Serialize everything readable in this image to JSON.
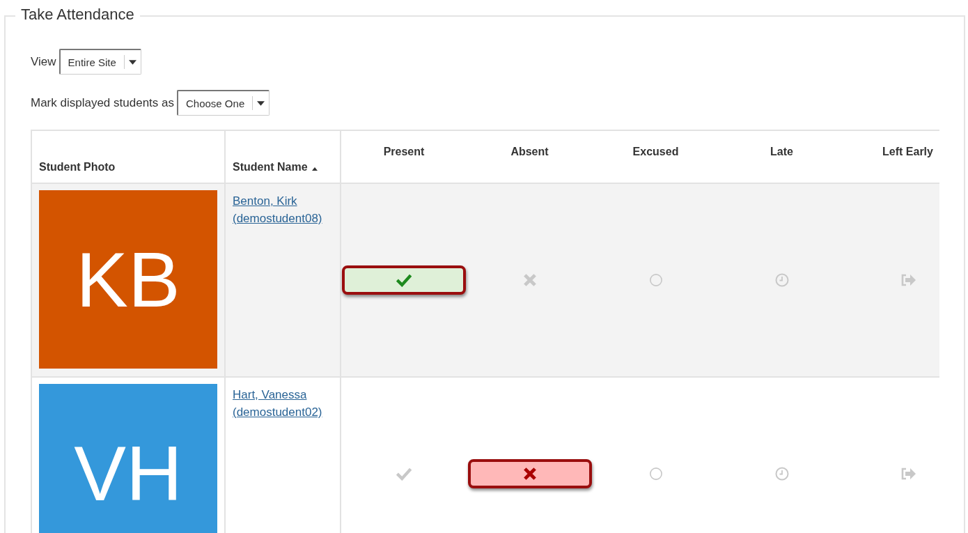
{
  "panel": {
    "title": "Take Attendance"
  },
  "view": {
    "label": "View",
    "value": "Entire Site"
  },
  "mark_all": {
    "label": "Mark displayed students as",
    "value": "Choose One"
  },
  "table": {
    "columns": [
      {
        "label": "Student Photo",
        "kind": "photo"
      },
      {
        "label": "Student Name",
        "kind": "name",
        "sorted": true
      },
      {
        "label": "Present",
        "kind": "present"
      },
      {
        "label": "Absent",
        "kind": "absent"
      },
      {
        "label": "Excused",
        "kind": "excused"
      },
      {
        "label": "Late",
        "kind": "late"
      },
      {
        "label": "Left Early",
        "kind": "left_early"
      }
    ],
    "rows": [
      {
        "initials": "KB",
        "color": "#d35400",
        "name": "Benton, Kirk (demostudent08)",
        "shaded": true,
        "statuses": [
          {
            "kind": "present",
            "selected": true
          },
          {
            "kind": "absent",
            "selected": false
          },
          {
            "kind": "excused",
            "selected": false
          },
          {
            "kind": "late",
            "selected": false
          },
          {
            "kind": "left_early",
            "selected": false
          }
        ]
      },
      {
        "initials": "VH",
        "color": "#3498db",
        "name": "Hart, Vanessa (demostudent02)",
        "shaded": false,
        "statuses": [
          {
            "kind": "present",
            "selected": false
          },
          {
            "kind": "absent",
            "selected": true
          },
          {
            "kind": "excused",
            "selected": false
          },
          {
            "kind": "late",
            "selected": false
          },
          {
            "kind": "left_early",
            "selected": false
          }
        ]
      }
    ]
  }
}
